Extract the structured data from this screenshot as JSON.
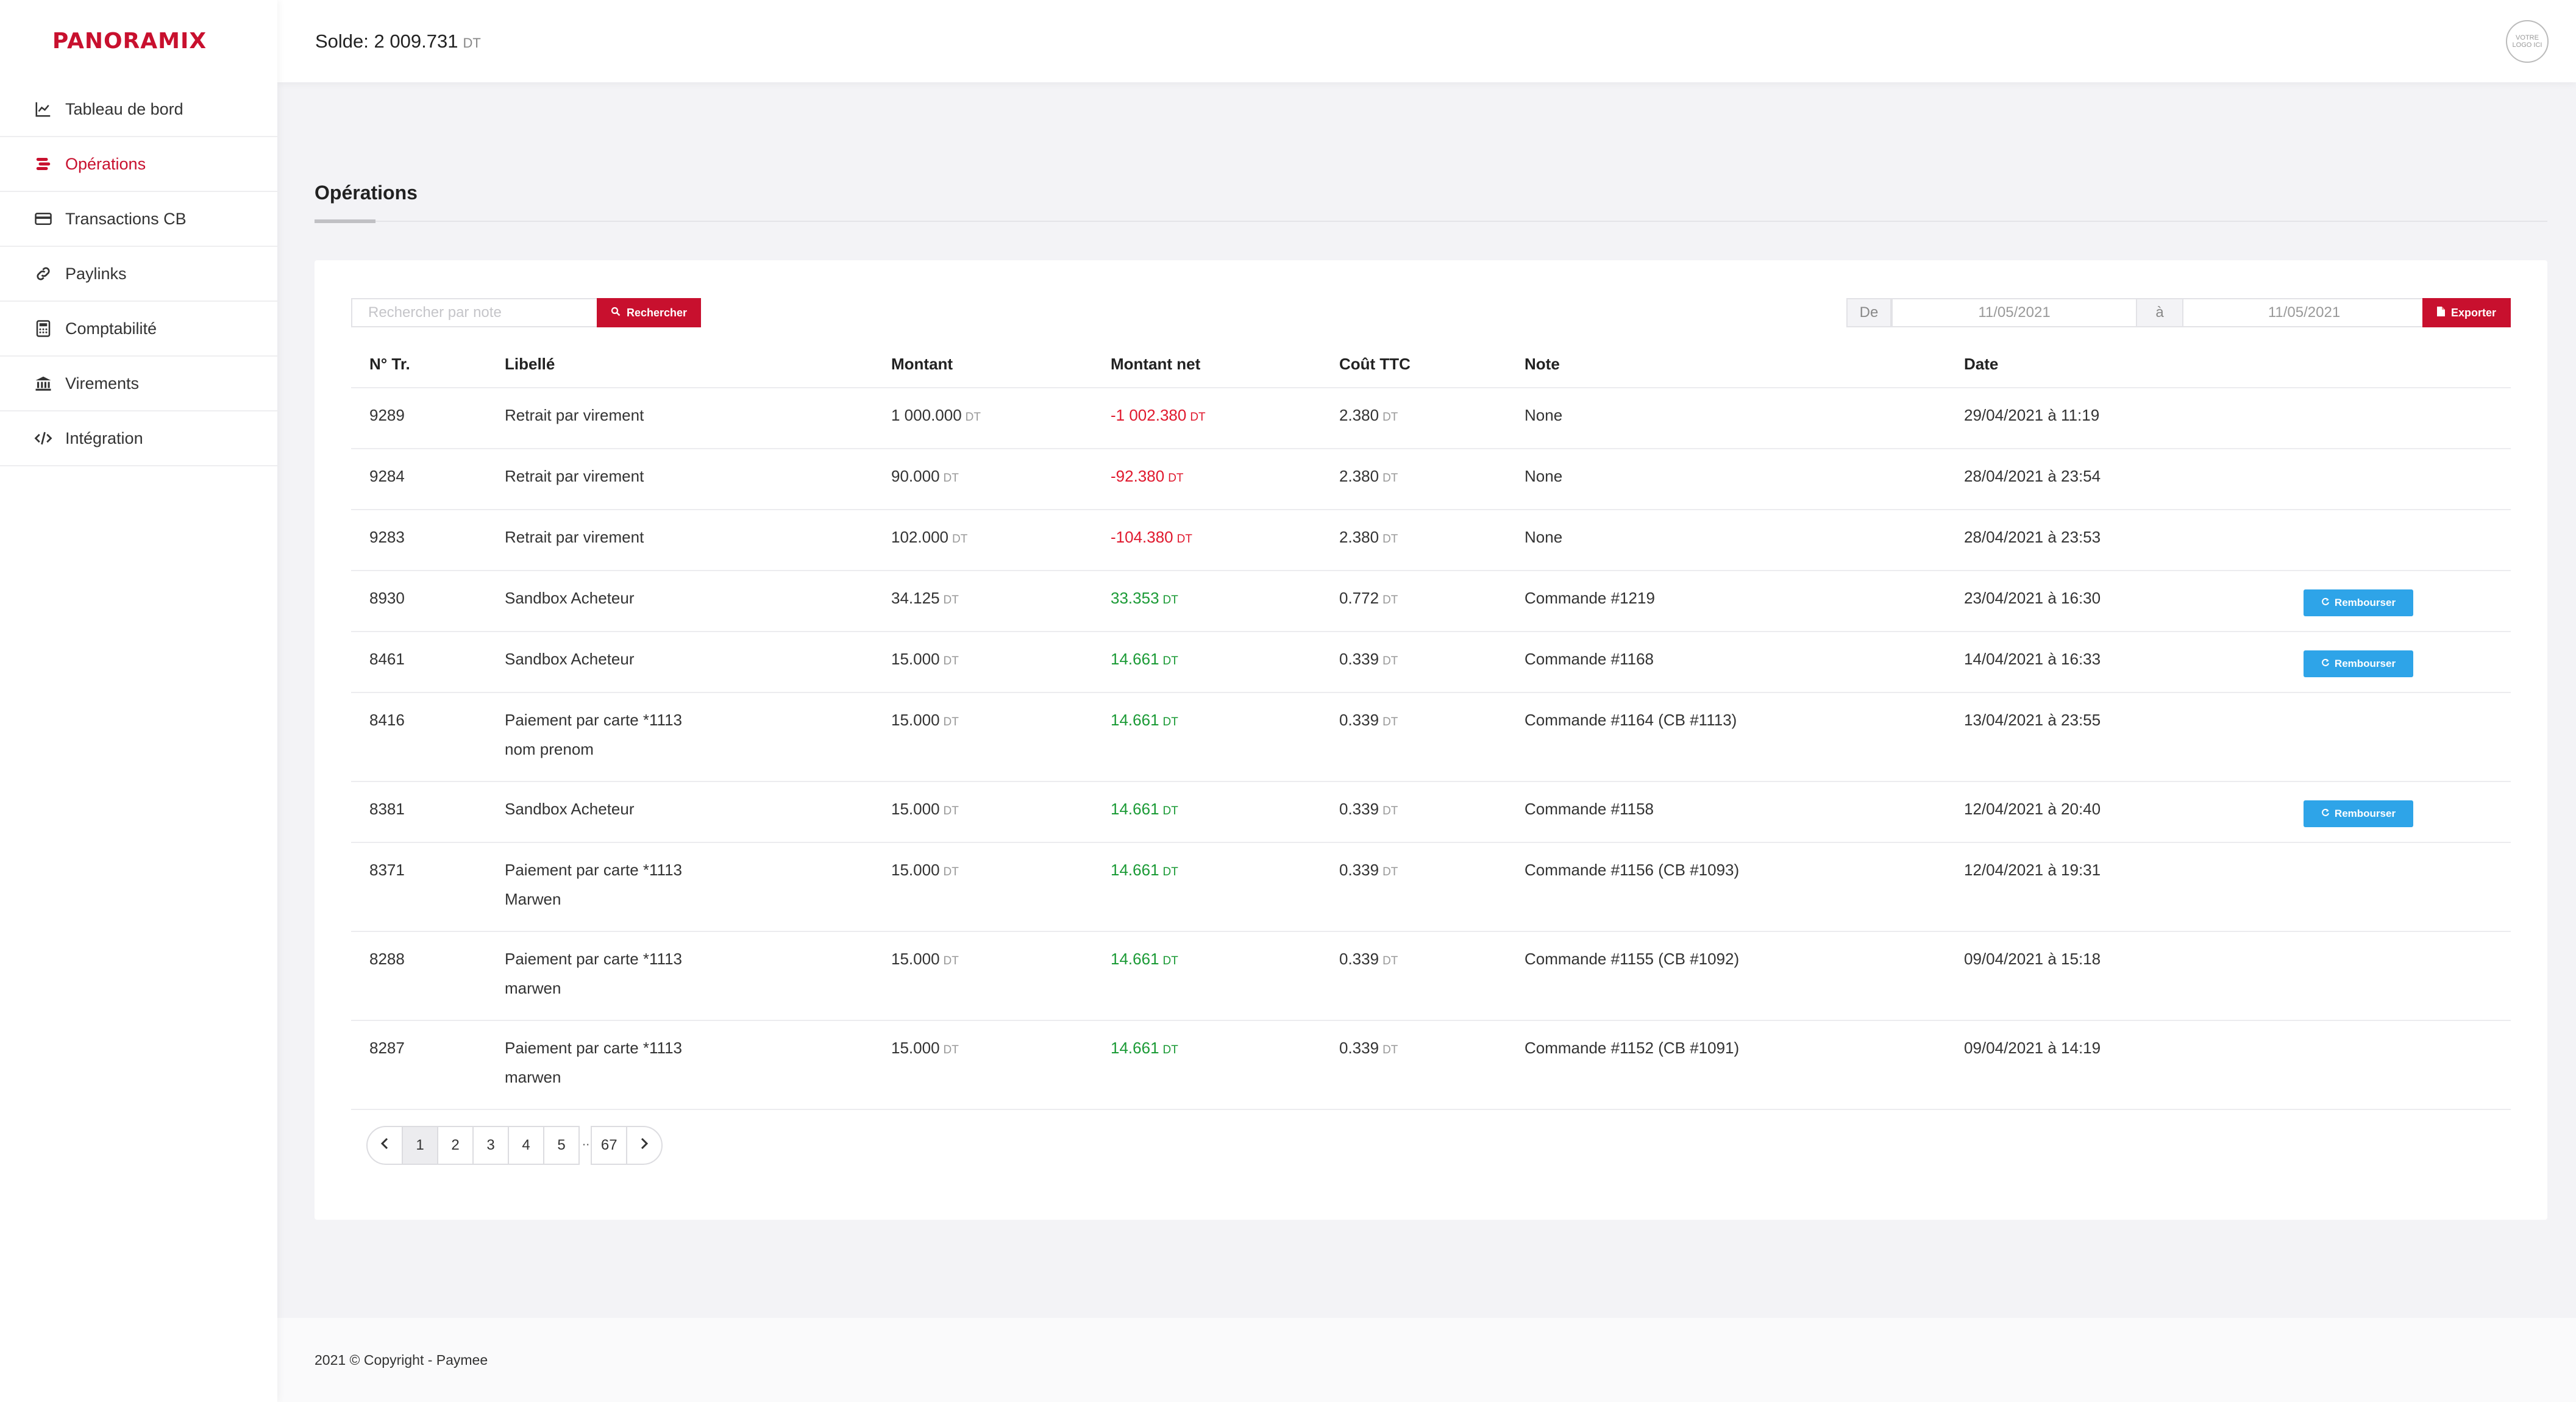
{
  "app": {
    "brand": "PANORAMIX",
    "balance_label": "Solde:",
    "balance_value": "2 009.731",
    "currency": "DT",
    "logo_placeholder": "VOTRE LOGO ICI",
    "accent_color": "#c8102e"
  },
  "sidebar": {
    "items": [
      {
        "label": "Tableau de bord",
        "icon": "chart-line-icon",
        "active": false
      },
      {
        "label": "Opérations",
        "icon": "coins-icon",
        "active": true
      },
      {
        "label": "Transactions CB",
        "icon": "credit-card-icon",
        "active": false
      },
      {
        "label": "Paylinks",
        "icon": "link-icon",
        "active": false
      },
      {
        "label": "Comptabilité",
        "icon": "calculator-icon",
        "active": false
      },
      {
        "label": "Virements",
        "icon": "bank-icon",
        "active": false
      },
      {
        "label": "Intégration",
        "icon": "code-icon",
        "active": false
      }
    ]
  },
  "page": {
    "title": "Opérations"
  },
  "toolbar": {
    "search_placeholder": "Rechercher par note",
    "search_label": "Rechercher",
    "date_from_label": "De",
    "date_from": "11/05/2021",
    "date_to_label": "à",
    "date_to": "11/05/2021",
    "export_label": "Exporter"
  },
  "table": {
    "headers": [
      "N° Tr.",
      "Libellé",
      "Montant",
      "Montant net",
      "Coût TTC",
      "Note",
      "Date"
    ],
    "refund_label": "Rembourser",
    "rows": [
      {
        "id": "9289",
        "libelle": "Retrait par virement",
        "libelle2": "",
        "montant": "1 000.000",
        "net": "-1 002.380",
        "net_type": "neg",
        "cout": "2.380",
        "note": "None",
        "date": "29/04/2021 à 11:19",
        "refund": false
      },
      {
        "id": "9284",
        "libelle": "Retrait par virement",
        "libelle2": "",
        "montant": "90.000",
        "net": "-92.380",
        "net_type": "neg",
        "cout": "2.380",
        "note": "None",
        "date": "28/04/2021 à 23:54",
        "refund": false
      },
      {
        "id": "9283",
        "libelle": "Retrait par virement",
        "libelle2": "",
        "montant": "102.000",
        "net": "-104.380",
        "net_type": "neg",
        "cout": "2.380",
        "note": "None",
        "date": "28/04/2021 à 23:53",
        "refund": false
      },
      {
        "id": "8930",
        "libelle": "Sandbox Acheteur",
        "libelle2": "",
        "montant": "34.125",
        "net": "33.353",
        "net_type": "pos",
        "cout": "0.772",
        "note": "Commande #1219",
        "date": "23/04/2021 à 16:30",
        "refund": true
      },
      {
        "id": "8461",
        "libelle": "Sandbox Acheteur",
        "libelle2": "",
        "montant": "15.000",
        "net": "14.661",
        "net_type": "pos",
        "cout": "0.339",
        "note": "Commande #1168",
        "date": "14/04/2021 à 16:33",
        "refund": true
      },
      {
        "id": "8416",
        "libelle": "Paiement par carte *1113",
        "libelle2": "nom prenom",
        "montant": "15.000",
        "net": "14.661",
        "net_type": "pos",
        "cout": "0.339",
        "note": "Commande #1164 (CB #1113)",
        "date": "13/04/2021 à 23:55",
        "refund": false
      },
      {
        "id": "8381",
        "libelle": "Sandbox Acheteur",
        "libelle2": "",
        "montant": "15.000",
        "net": "14.661",
        "net_type": "pos",
        "cout": "0.339",
        "note": "Commande #1158",
        "date": "12/04/2021 à 20:40",
        "refund": true
      },
      {
        "id": "8371",
        "libelle": "Paiement par carte *1113",
        "libelle2": "Marwen",
        "montant": "15.000",
        "net": "14.661",
        "net_type": "pos",
        "cout": "0.339",
        "note": "Commande #1156 (CB #1093)",
        "date": "12/04/2021 à 19:31",
        "refund": false
      },
      {
        "id": "8288",
        "libelle": "Paiement par carte *1113",
        "libelle2": "marwen",
        "montant": "15.000",
        "net": "14.661",
        "net_type": "pos",
        "cout": "0.339",
        "note": "Commande #1155 (CB #1092)",
        "date": "09/04/2021 à 15:18",
        "refund": false
      },
      {
        "id": "8287",
        "libelle": "Paiement par carte *1113",
        "libelle2": "marwen",
        "montant": "15.000",
        "net": "14.661",
        "net_type": "pos",
        "cout": "0.339",
        "note": "Commande #1152 (CB #1091)",
        "date": "09/04/2021 à 14:19",
        "refund": false
      }
    ]
  },
  "pagination": {
    "pages": [
      "1",
      "2",
      "3",
      "4",
      "5"
    ],
    "current": "1",
    "ellipsis": "..",
    "last": "67"
  },
  "footer": {
    "text": "2021 © Copyright - Paymee"
  }
}
